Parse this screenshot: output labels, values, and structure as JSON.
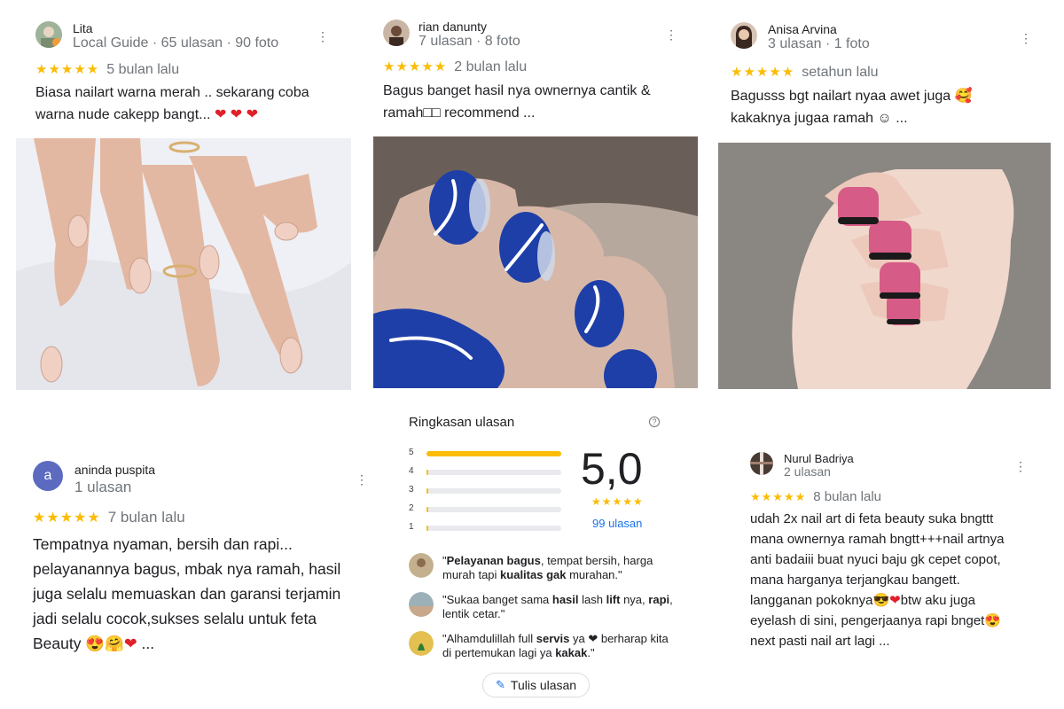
{
  "reviews": {
    "lita": {
      "name": "Lita",
      "meta": "Local Guide · 65 ulasan · 90 foto",
      "stars": "★★★★★",
      "when": "5 bulan lalu",
      "text_lines": [
        "Biasa nailart warna merah .. sekarang coba",
        "warna nude cakepp bangt..."
      ]
    },
    "rian": {
      "name": "rian danunty",
      "meta": "7 ulasan · 8 foto",
      "stars": "★★★★★",
      "when": "2 bulan lalu",
      "text_lines": [
        "Bagus banget hasil nya ownernya cantik &",
        "ramah□□ recommend ..."
      ]
    },
    "anisa": {
      "name": "Anisa Arvina",
      "meta": "3 ulasan · 1 foto",
      "stars": "★★★★★",
      "when": "setahun lalu",
      "text_lines": [
        "Bagusss bgt nailart nyaa awet juga",
        "kakaknya jugaa ramah ☺ ..."
      ]
    },
    "aninda": {
      "name": "aninda puspita",
      "avatar_letter": "a",
      "meta": "1 ulasan",
      "stars": "★★★★★",
      "when": "7 bulan lalu",
      "text_lines": [
        "Tempatnya nyaman, bersih dan rapi...",
        "pelayanannya bagus, mbak nya ramah, hasil",
        "juga selalu memuaskan dan garansi terjamin",
        "jadi selalu cocok,sukses selalu untuk feta",
        "Beauty"
      ],
      "text_tail": "..."
    },
    "nurul": {
      "name": "Nurul Badriya",
      "meta": "2 ulasan",
      "stars": "★★★★★",
      "when": "8 bulan lalu",
      "text_lines": [
        "udah 2x nail art di feta beauty suka bngttt",
        "mana ownernya ramah bngtt+++nail artnya",
        "anti badaiii buat nyuci baju gk cepet copot,",
        "mana harganya terjangkau bangett.",
        "langganan pokoknya",
        "eyelash di sini, pengerjaanya rapi bnget",
        "next pasti nail art lagi ..."
      ],
      "line5_tail": "btw aku juga"
    }
  },
  "summary": {
    "title": "Ringkasan ulasan",
    "bars": [
      {
        "label": "5",
        "fraction": 1.0
      },
      {
        "label": "4",
        "fraction": 0.01
      },
      {
        "label": "3",
        "fraction": 0.01
      },
      {
        "label": "2",
        "fraction": 0.01
      },
      {
        "label": "1",
        "fraction": 0.01
      }
    ],
    "score": "5,0",
    "stars": "★★★★★",
    "count_link": "99 ulasan",
    "quotes": [
      {
        "parts": [
          "\"",
          "Pelayanan bagus",
          ", tempat bersih, harga",
          " murah tapi ",
          "kualitas gak",
          " murahan.\""
        ]
      },
      {
        "parts": [
          "\"Sukaa banget sama ",
          "hasil",
          " lash ",
          "lift",
          " nya,",
          " ",
          "rapi",
          ", lentik cetar.\""
        ]
      },
      {
        "parts": [
          "\"Alhamdulillah full ",
          "servis",
          " ya ❤ berharap",
          " kita di pertemukan lagi ya ",
          "kakak",
          ".\""
        ]
      }
    ],
    "write_button": "Tulis ulasan"
  },
  "colors": {
    "star": "#fbbc04",
    "link": "#1a73e8",
    "avatar_a": "#5c6bc0"
  }
}
